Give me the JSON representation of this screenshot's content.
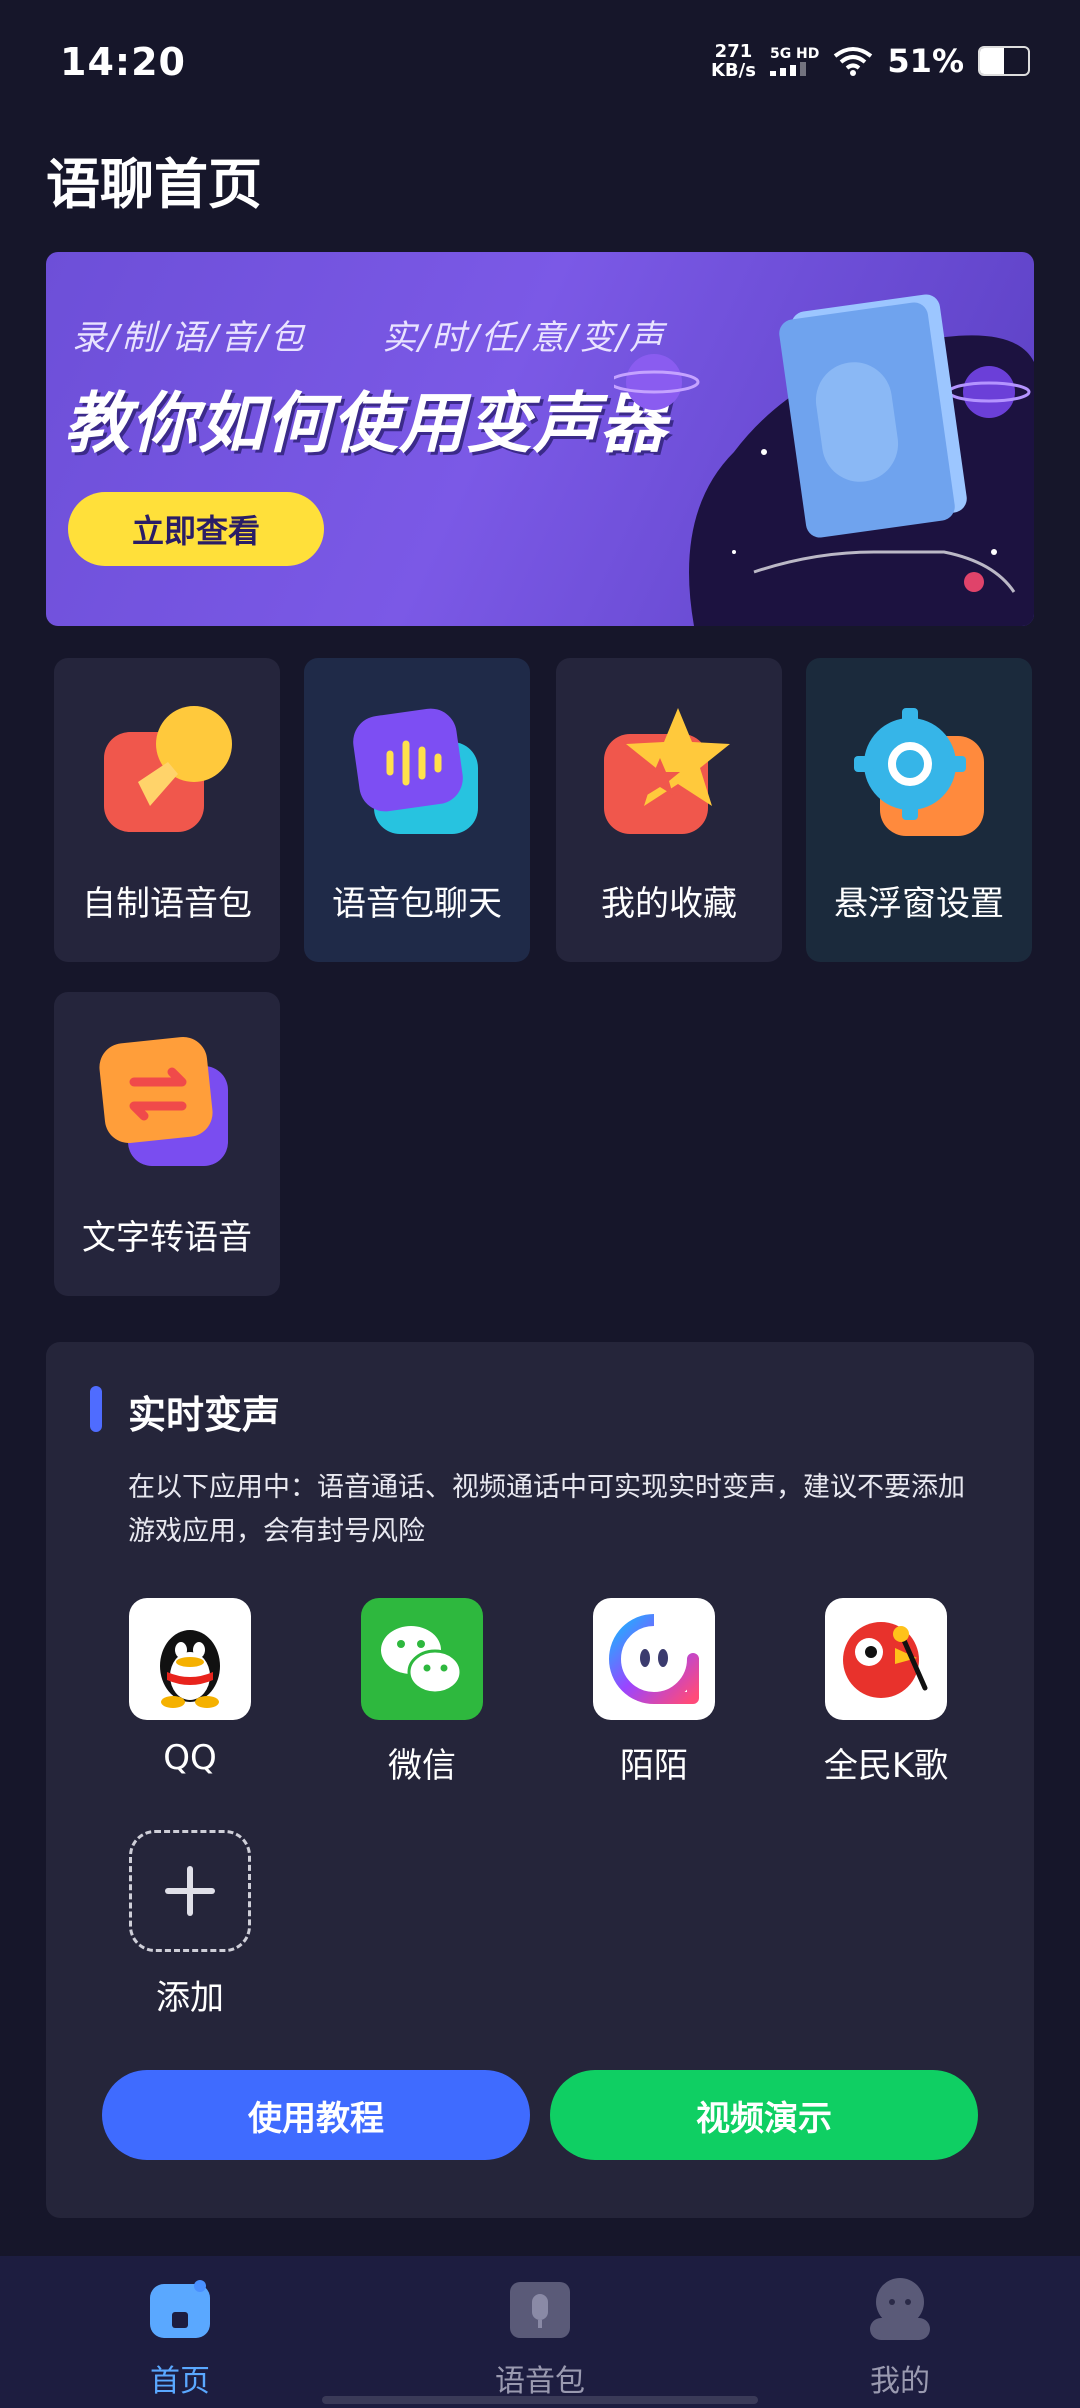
{
  "status": {
    "time": "14:20",
    "net_speed": "271",
    "net_unit": "KB/s",
    "signal_label": "5G HD",
    "battery": "51%",
    "battery_level": 0.51
  },
  "page_title": "语聊首页",
  "banner": {
    "sub_left": "录/制/语/音/包",
    "sub_right": "实/时/任/意/变/声",
    "headline": "教你如何使用变声器",
    "cta": "立即查看"
  },
  "features": [
    {
      "label": "自制语音包",
      "icon": "microphone-icon"
    },
    {
      "label": "语音包聊天",
      "icon": "voice-chat-icon"
    },
    {
      "label": "我的收藏",
      "icon": "star-icon"
    },
    {
      "label": "悬浮窗设置",
      "icon": "gear-icon"
    },
    {
      "label": "文字转语音",
      "icon": "convert-icon"
    }
  ],
  "realtime": {
    "title": "实时变声",
    "description": "在以下应用中：语音通话、视频通话中可实现实时变声，建议不要添加游戏应用，会有封号风险",
    "apps": [
      {
        "name": "QQ",
        "icon": "qq-icon"
      },
      {
        "name": "微信",
        "icon": "wechat-icon"
      },
      {
        "name": "陌陌",
        "icon": "momo-icon"
      },
      {
        "name": "全民K歌",
        "icon": "kge-icon"
      }
    ],
    "add_label": "添加",
    "tutorial_button": "使用教程",
    "video_button": "视频演示"
  },
  "tabs": [
    {
      "label": "首页",
      "active": true
    },
    {
      "label": "语音包",
      "active": false
    },
    {
      "label": "我的",
      "active": false
    }
  ],
  "colors": {
    "accent_blue": "#3f6bff",
    "accent_green": "#0fcf63",
    "tab_active": "#5aa8ff",
    "tab_inactive": "#9a9ab0"
  }
}
